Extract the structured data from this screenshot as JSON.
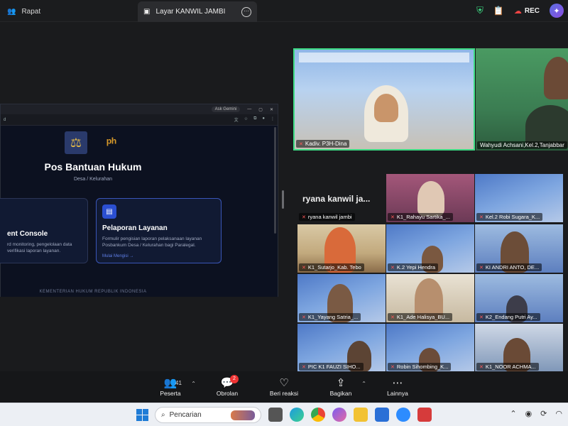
{
  "topbar": {
    "meeting_tab": "Rapat",
    "share_tab": "Layar KANWIL JAMBI",
    "rec_label": "REC"
  },
  "shared_screen": {
    "browser_button": "Ask Gemini",
    "page_title": "Pos Bantuan Hukum",
    "page_subtitle": "Desa / Kelurahan",
    "card1": {
      "title": "ent Console",
      "desc_line1": "rd monitoring, pengelolaan data",
      "desc_line2": "verifikasi laporan layanan."
    },
    "card2": {
      "title": "Pelaporan Layanan",
      "desc_line1": "Formulir pengisian laporan pelaksanaan layanan",
      "desc_line2": "Posbankum Desa / Kelurahan bagi Paralegal.",
      "link": "Mulai Mengisi"
    },
    "footer": "KEMENTERIAN HUKUM REPUBLIK INDONESIA"
  },
  "top_tiles": [
    {
      "name": "Kadiv. P3H-Dina"
    },
    {
      "name": "Wahyudi Achsani,Kel.2,Tanjabbar"
    }
  ],
  "gallery": {
    "heading": "ryana kanwil ja...",
    "tiles": [
      {
        "name": "ryana kanwil jambi"
      },
      {
        "name": "K1_Rahayu Sartika_..."
      },
      {
        "name": "Kel.2 Robi Sugara_K..."
      },
      {
        "name": "K1_Sutarjo_Kab. Tebo"
      },
      {
        "name": "K.2 Yepi Hendra"
      },
      {
        "name": "KI ANDRI ANTO, DE..."
      },
      {
        "name": "K1_Yayang Satria_..."
      },
      {
        "name": "K1_Ade Halisya_BU..."
      },
      {
        "name": "K2_Endang Putri Ay..."
      },
      {
        "name": "PIC K1 FAUZI SIHO..."
      },
      {
        "name": "Robin Sihombing_K..."
      },
      {
        "name": "K1_NOOR ACHMA..."
      }
    ]
  },
  "toolbar": {
    "participants_label": "Peserta",
    "participants_count": "41",
    "chat_label": "Obrolan",
    "chat_badge": "2",
    "react_label": "Beri reaksi",
    "share_label": "Bagikan",
    "more_label": "Lainnya"
  },
  "taskbar": {
    "search_placeholder": "Pencarian"
  },
  "colors": {
    "active_speaker_border": "#3ddc84",
    "rec_dot": "#e44444",
    "accent_blue": "#2b4fd1"
  }
}
